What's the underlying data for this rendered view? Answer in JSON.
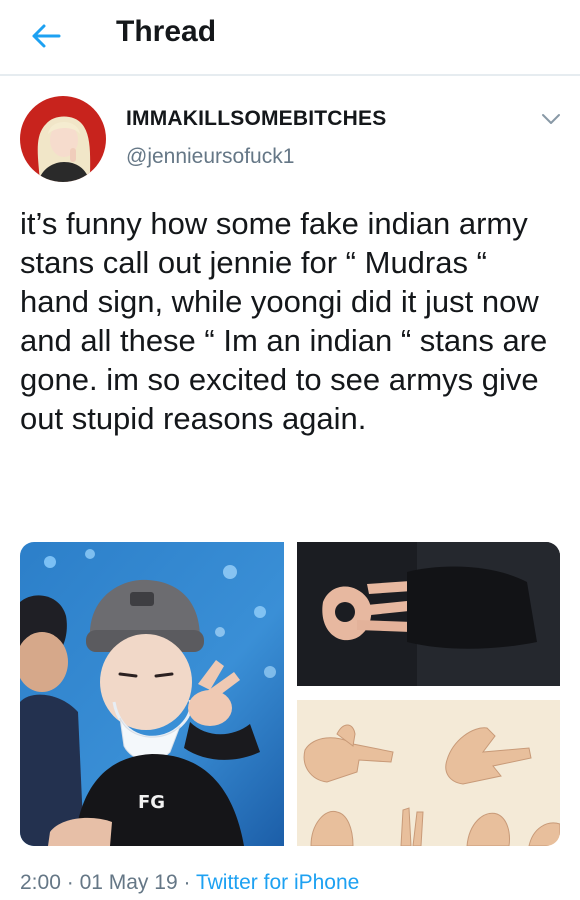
{
  "header": {
    "title": "Thread",
    "back_icon": "arrow-left-icon",
    "accent_color": "#1da1f2"
  },
  "tweet": {
    "display_name": "IMMAKILLSOMEBITCHES",
    "handle": "@jennieursofuck1",
    "menu_icon": "chevron-down-icon",
    "text": "it’s funny how some fake indian army stans call out jennie for “ Mudras “ hand sign, while yoongi did it just now and all these “ Im an indian “ stans are gone. im so excited to see armys give out stupid reasons again.",
    "media": {
      "count": 3,
      "shirt_logo_text": "FG"
    },
    "time": "2:00",
    "date": "01 May 19",
    "separator": "·",
    "source": "Twitter for iPhone"
  },
  "colors": {
    "text": "#14171a",
    "secondary": "#657786",
    "link": "#1da1f2",
    "divider": "#e6ecf0"
  }
}
